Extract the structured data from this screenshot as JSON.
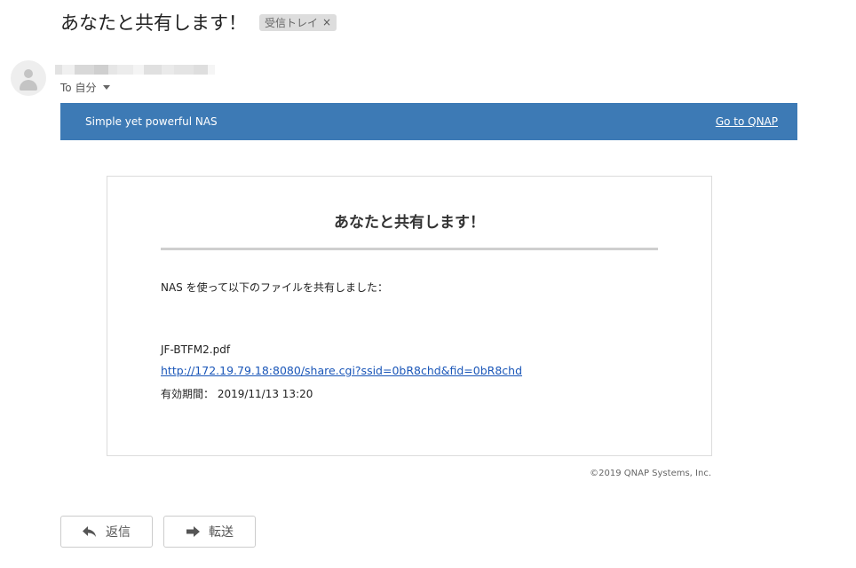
{
  "email": {
    "subject": "あなたと共有します！",
    "label": "受信トレイ",
    "label_remove": "×",
    "to": "To 自分"
  },
  "banner": {
    "tagline": "Simple yet powerful NAS",
    "link": "Go to QNAP"
  },
  "body": {
    "title": "あなたと共有します！",
    "intro": "NAS を使って以下のファイルを共有しました：",
    "file_name": "JF-BTFM2.pdf",
    "share_url": "http://172.19.79.18:8080/share.cgi?ssid=0bR8chd&fid=0bR8chd",
    "expiry": "有効期間： 2019/11/13 13:20",
    "copyright": "©2019 QNAP Systems, Inc."
  },
  "actions": {
    "reply": "返信",
    "forward": "転送"
  },
  "colors": {
    "banner_bg": "#3d7ab5",
    "link": "#1a56b8"
  },
  "icons": {
    "avatar": "person-icon",
    "reply": "reply-arrow-icon",
    "forward": "forward-arrow-icon",
    "to_dropdown": "caret-down-icon"
  }
}
